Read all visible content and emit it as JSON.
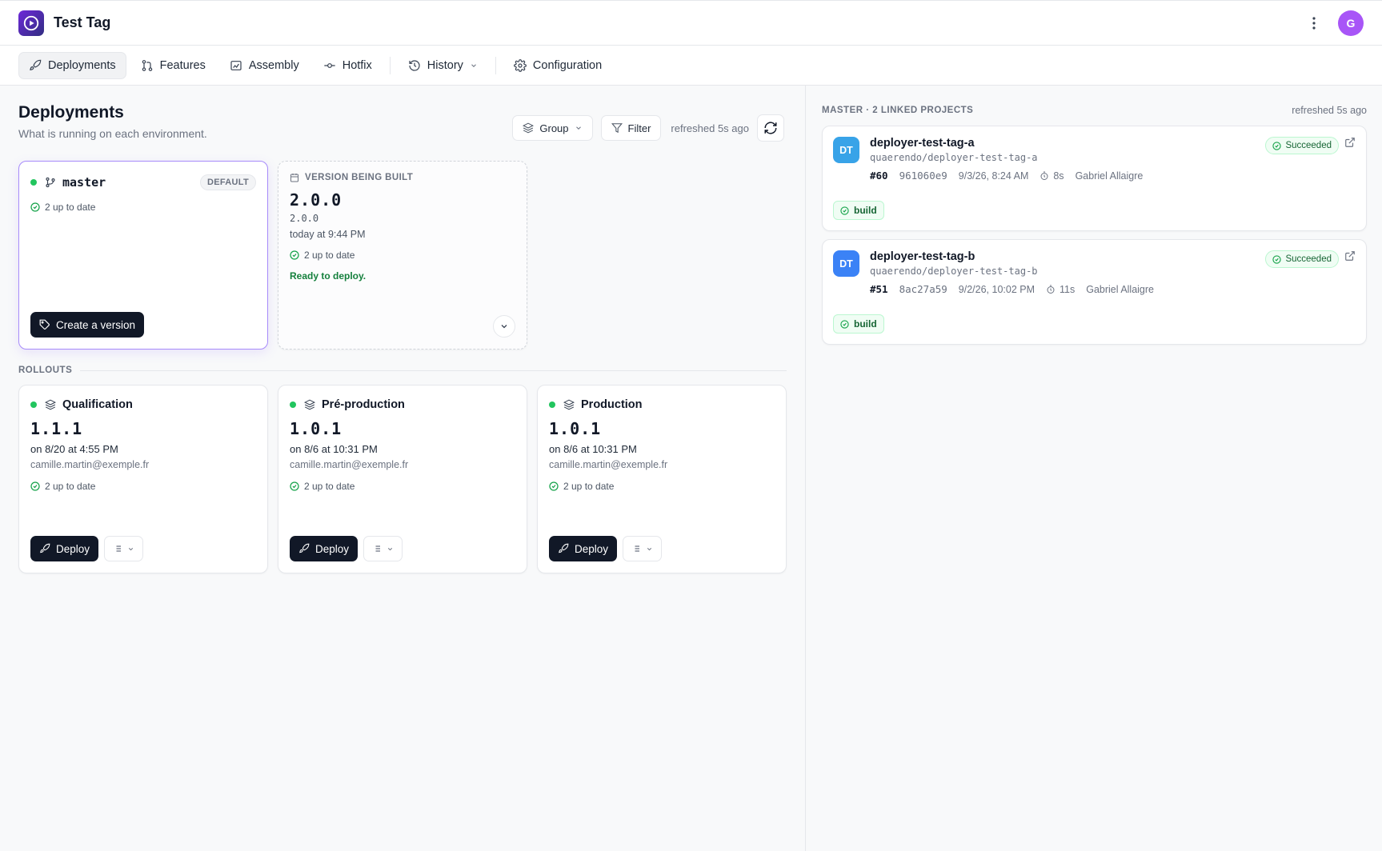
{
  "app": {
    "title": "Test Tag",
    "avatar_initial": "G"
  },
  "tabs": [
    {
      "label": "Deployments",
      "icon": "rocket-icon",
      "active": true
    },
    {
      "label": "Features",
      "icon": "git-pull-request-icon"
    },
    {
      "label": "Assembly",
      "icon": "assembly-icon"
    },
    {
      "label": "Hotfix",
      "icon": "git-commit-icon"
    },
    {
      "label": "History",
      "icon": "history-icon"
    },
    {
      "label": "Configuration",
      "icon": "gear-icon"
    }
  ],
  "page": {
    "title": "Deployments",
    "subtitle": "What is running on each environment.",
    "group_label": "Group",
    "filter_label": "Filter",
    "refreshed": "refreshed 5s ago"
  },
  "branch_card": {
    "name": "master",
    "badge": "DEFAULT",
    "status": "2 up to date",
    "create_label": "Create a version"
  },
  "version_card": {
    "label": "VERSION BEING BUILT",
    "version": "2.0.0",
    "sub_version": "2.0.0",
    "time": "today at 9:44 PM",
    "status": "2 up to date",
    "ready": "Ready to deploy."
  },
  "rollouts": {
    "label": "ROLLOUTS",
    "envs": [
      {
        "name": "Qualification",
        "version": "1.1.1",
        "date": "on 8/20 at 4:55 PM",
        "email": "camille.martin@exemple.fr",
        "status": "2 up to date",
        "deploy_label": "Deploy"
      },
      {
        "name": "Pré-production",
        "version": "1.0.1",
        "date": "on 8/6 at 10:31 PM",
        "email": "camille.martin@exemple.fr",
        "status": "2 up to date",
        "deploy_label": "Deploy"
      },
      {
        "name": "Production",
        "version": "1.0.1",
        "date": "on 8/6 at 10:31 PM",
        "email": "camille.martin@exemple.fr",
        "status": "2 up to date",
        "deploy_label": "Deploy"
      }
    ]
  },
  "right_panel": {
    "header": "MASTER · 2 LINKED PROJECTS",
    "refreshed": "refreshed 5s ago",
    "projects": [
      {
        "initials": "DT",
        "color": "#38a3e8",
        "name": "deployer-test-tag-a",
        "repo": "quaerendo/deployer-test-tag-a",
        "run": "#60",
        "sha": "961060e9",
        "date": "9/3/26, 8:24 AM",
        "duration": "8s",
        "author": "Gabriel Allaigre",
        "status": "Succeeded",
        "job": "build"
      },
      {
        "initials": "DT",
        "color": "#3b82f6",
        "name": "deployer-test-tag-b",
        "repo": "quaerendo/deployer-test-tag-b",
        "run": "#51",
        "sha": "8ac27a59",
        "date": "9/2/26, 10:02 PM",
        "duration": "11s",
        "author": "Gabriel Allaigre",
        "status": "Succeeded",
        "job": "build"
      }
    ]
  },
  "colors": {
    "accent": "#8b5cf6",
    "success": "#22c55e",
    "dark": "#111827"
  }
}
